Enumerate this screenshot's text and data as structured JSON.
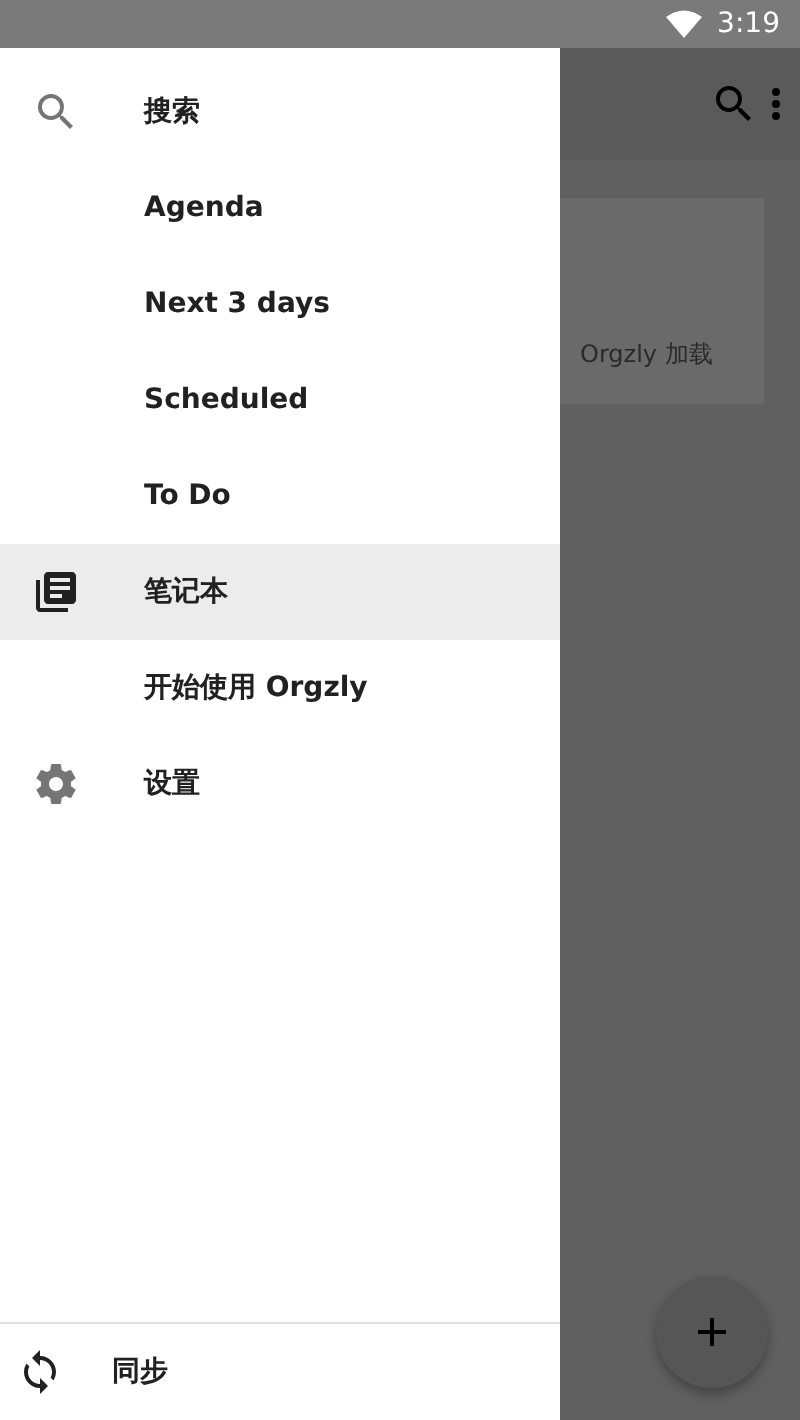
{
  "status_bar": {
    "time": "3:19"
  },
  "drawer": {
    "items": [
      {
        "label": "搜索",
        "selected": false
      },
      {
        "label": "Agenda",
        "selected": false
      },
      {
        "label": "Next 3 days",
        "selected": false
      },
      {
        "label": "Scheduled",
        "selected": false
      },
      {
        "label": "To Do",
        "selected": false
      },
      {
        "label": "笔记本",
        "selected": true
      },
      {
        "label": "开始使用 Orgzly",
        "selected": false
      },
      {
        "label": "设置",
        "selected": false
      }
    ],
    "footer": {
      "label": "同步"
    }
  },
  "background": {
    "card_text": "Orgzly 加载"
  }
}
